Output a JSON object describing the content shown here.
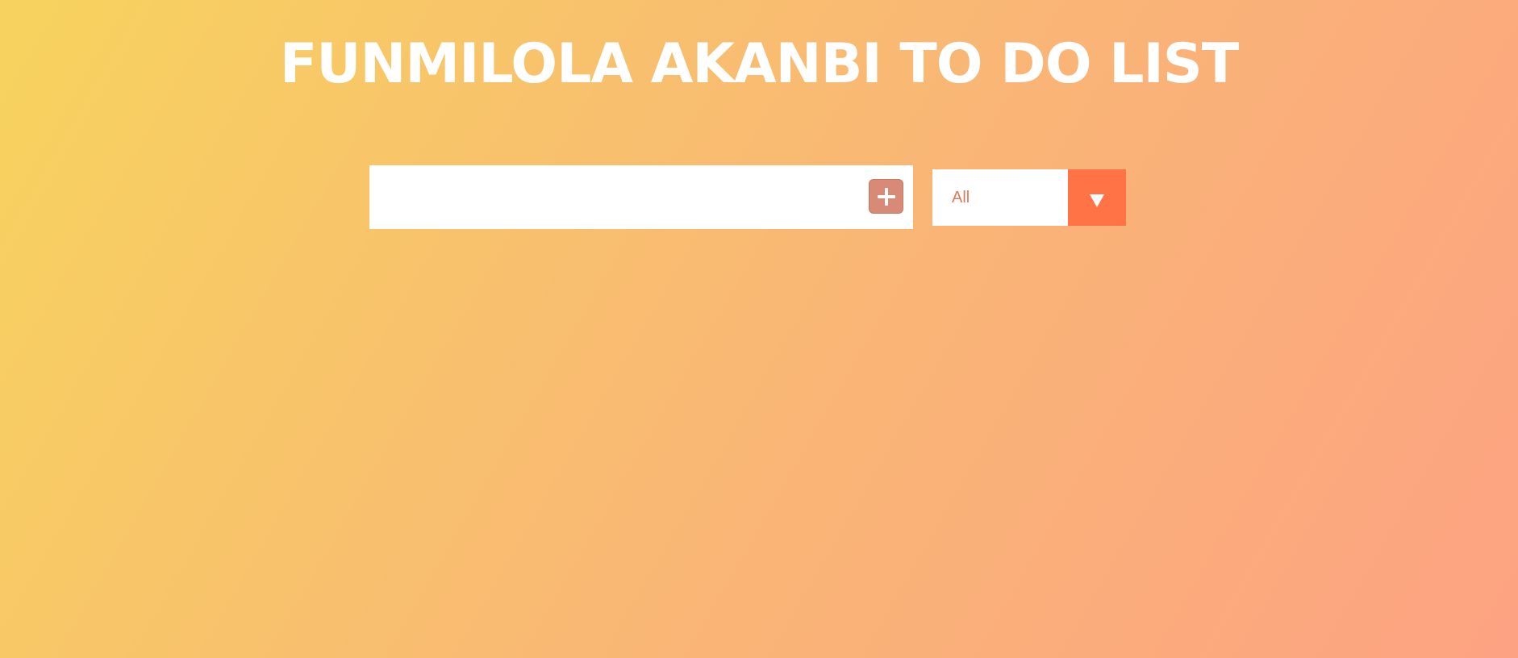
{
  "header": {
    "title": "FUNMILOLA AKANBI TO DO LIST"
  },
  "todo_form": {
    "input_value": "",
    "input_placeholder": "",
    "add_button_icon": "plus-icon"
  },
  "filter": {
    "selected": "All",
    "arrow_icon": "chevron-down-icon"
  },
  "todos": [],
  "colors": {
    "gradient_start": "#f7d35e",
    "gradient_end": "#fda282",
    "add_button": "#d98a76",
    "filter_arrow": "#ff7347",
    "filter_text": "#e07a5a"
  }
}
